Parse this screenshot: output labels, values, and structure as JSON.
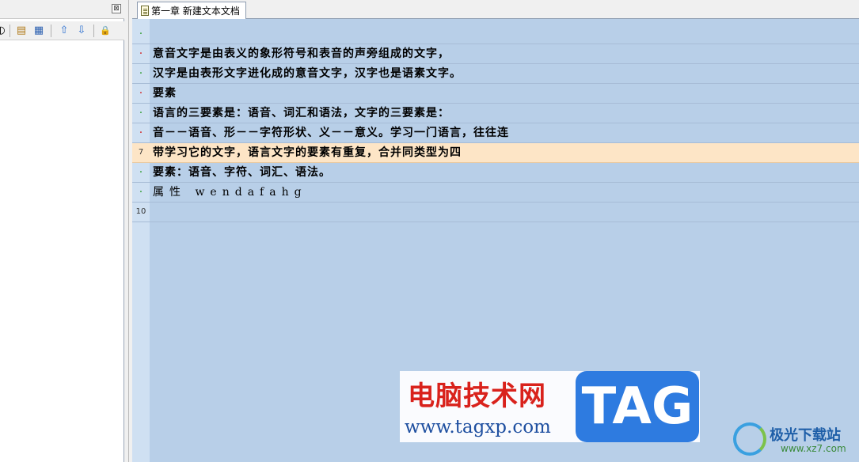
{
  "left_panel": {
    "close_glyph": "⊠",
    "toolbar": [
      {
        "name": "partial-button",
        "glyph": "◐"
      },
      {
        "name": "properties-button",
        "glyph": "▤"
      },
      {
        "name": "edit-button",
        "glyph": "▦"
      },
      {
        "name": "move-up-button",
        "glyph": "⇧"
      },
      {
        "name": "move-down-button",
        "glyph": "⇩"
      },
      {
        "name": "lock-button",
        "glyph": "🔒"
      }
    ]
  },
  "tab": {
    "label": "第一章 新建文本文档"
  },
  "editor": {
    "current_line": 7,
    "lines": [
      {
        "gutter": "·",
        "gutter_kind": "green",
        "text": ""
      },
      {
        "gutter": "·",
        "gutter_kind": "red",
        "text": "意音文字是由表义的象形符号和表音的声旁组成的文字，"
      },
      {
        "gutter": "·",
        "gutter_kind": "green",
        "text": "汉字是由表形文字进化成的意音文字，汉字也是语素文字。"
      },
      {
        "gutter": "·",
        "gutter_kind": "red",
        "text": "要素"
      },
      {
        "gutter": "·",
        "gutter_kind": "green",
        "text": "语言的三要素是：语音、词汇和语法，文字的三要素是："
      },
      {
        "gutter": "·",
        "gutter_kind": "red",
        "text": "音－－语音、形－－字符形状、义－－意义。学习一门语言，往往连"
      },
      {
        "gutter": "7",
        "gutter_kind": "number",
        "text": "带学习它的文字，语言文字的要素有重复，合并同类型为四"
      },
      {
        "gutter": "·",
        "gutter_kind": "green",
        "text": "要素：语音、字符、词汇、语法。"
      },
      {
        "gutter": "·",
        "gutter_kind": "green",
        "text": "属性 wendafahg"
      },
      {
        "gutter": "10",
        "gutter_kind": "number",
        "text": ""
      }
    ]
  },
  "watermark": {
    "cn": "电脑技术网",
    "url": "www.tagxp.com",
    "tag": "TAG"
  },
  "watermark2": {
    "cn": "极光下载站",
    "url": "www.xz7.com"
  }
}
